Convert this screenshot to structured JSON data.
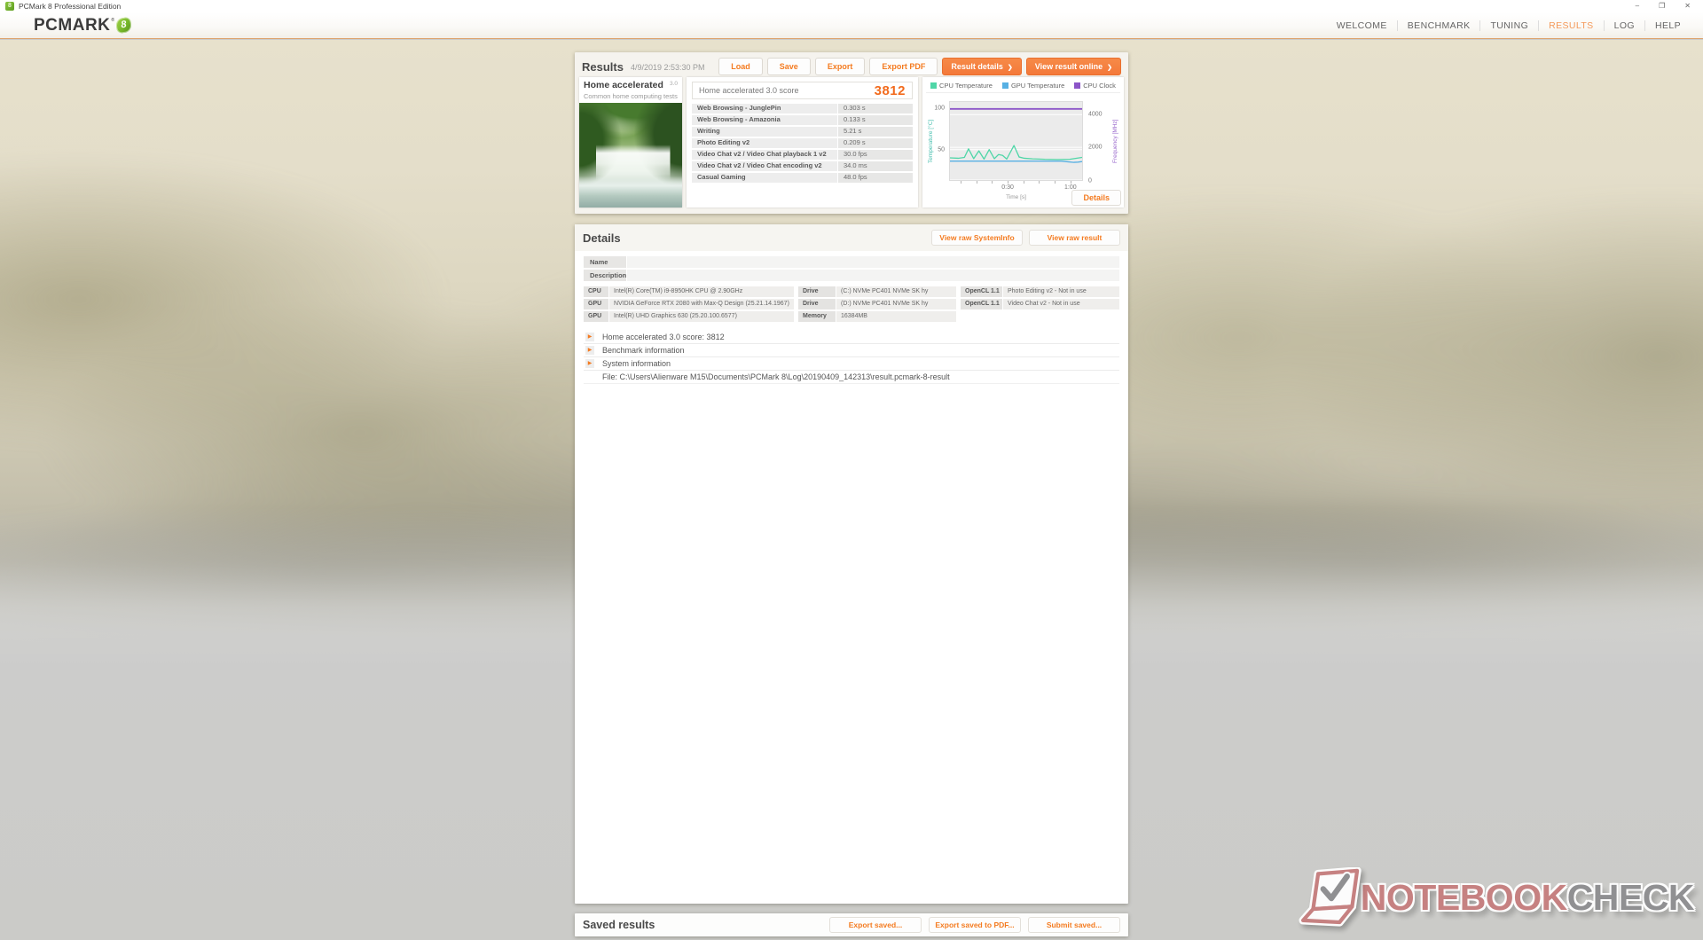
{
  "window": {
    "title": "PCMark 8 Professional Edition",
    "controls": {
      "minimize": "–",
      "maximize": "❐",
      "close": "✕"
    }
  },
  "header": {
    "logo_text": "PCMARK",
    "logo_reg": "®",
    "logo_mark": "8",
    "nav": [
      {
        "label": "WELCOME",
        "active": false
      },
      {
        "label": "BENCHMARK",
        "active": false
      },
      {
        "label": "TUNING",
        "active": false
      },
      {
        "label": "RESULTS",
        "active": true
      },
      {
        "label": "LOG",
        "active": false
      },
      {
        "label": "HELP",
        "active": false
      }
    ]
  },
  "icons": {
    "chevron_right": "❯",
    "expand_arrow": "▶"
  },
  "colors": {
    "accent_orange": "#f47b20",
    "button_orange": "#f4793a",
    "logo_green": "#76b82a"
  },
  "results_panel": {
    "title": "Results",
    "timestamp": "4/9/2019 2:53:30 PM",
    "buttons": {
      "load": "Load",
      "save": "Save",
      "export": "Export",
      "export_pdf": "Export PDF",
      "result_details": "Result details",
      "view_online": "View result online"
    },
    "benchmark": {
      "name": "Home accelerated",
      "version": "3.0",
      "subtitle": "Common home computing tests"
    },
    "score": {
      "label": "Home accelerated 3.0 score",
      "value": "3812"
    },
    "tests": [
      {
        "name": "Web Browsing - JunglePin",
        "value": "0.303 s"
      },
      {
        "name": "Web Browsing - Amazonia",
        "value": "0.133 s"
      },
      {
        "name": "Writing",
        "value": "5.21 s"
      },
      {
        "name": "Photo Editing v2",
        "value": "0.209 s"
      },
      {
        "name": "Video Chat v2 / Video Chat playback 1 v2",
        "value": "30.0 fps"
      },
      {
        "name": "Video Chat v2 / Video Chat encoding v2",
        "value": "34.0 ms"
      },
      {
        "name": "Casual Gaming",
        "value": "48.0 fps"
      }
    ],
    "chart_details_label": "Details"
  },
  "chart_data": {
    "type": "line",
    "title": "",
    "legend_position": "top",
    "grid": true,
    "plot_background": "#ebebeb",
    "x_range": [
      2,
      66
    ],
    "x_axis": {
      "label": "Time [s]",
      "ticks": [
        {
          "label": "0:30",
          "t": 30
        },
        {
          "label": "1:00",
          "t": 60
        }
      ],
      "minor_ticks": [
        7.5,
        15,
        22.5,
        30,
        37.5,
        45,
        52.5,
        60
      ]
    },
    "y_left": {
      "label": "Temperature [°C]",
      "ticks": [
        100,
        50
      ],
      "range": [
        13,
        108
      ],
      "color": "#4bc0b0"
    },
    "y_right": {
      "label": "Frequency [MHz]",
      "ticks": [
        4000,
        2000,
        0
      ],
      "range": [
        0,
        4775
      ],
      "color": "#9a68cc"
    },
    "series": [
      {
        "name": "CPU Temperature",
        "axis": "left",
        "unit": "°C",
        "color": "#4fd6a7",
        "points": [
          [
            2,
            40
          ],
          [
            6,
            39.5
          ],
          [
            9,
            40.5
          ],
          [
            11,
            51
          ],
          [
            13.5,
            39
          ],
          [
            16,
            48.5
          ],
          [
            18.5,
            38.5
          ],
          [
            21,
            50
          ],
          [
            23.5,
            39
          ],
          [
            25.5,
            44
          ],
          [
            27.5,
            43
          ],
          [
            29.5,
            38.5
          ],
          [
            33,
            55
          ],
          [
            35.5,
            41
          ],
          [
            38,
            39.5
          ],
          [
            42,
            38.8
          ],
          [
            48,
            38.2
          ],
          [
            54,
            38
          ],
          [
            60,
            38.2
          ],
          [
            66,
            40.5
          ]
        ]
      },
      {
        "name": "GPU Temperature",
        "axis": "left",
        "unit": "°C",
        "color": "#57b0e3",
        "points": [
          [
            2,
            36
          ],
          [
            20,
            36
          ],
          [
            40,
            36
          ],
          [
            56,
            36
          ],
          [
            59,
            35.2
          ],
          [
            62,
            34.5
          ],
          [
            64,
            34.8
          ],
          [
            66,
            35.5
          ]
        ]
      },
      {
        "name": "CPU Clock",
        "axis": "right",
        "unit": "MHz",
        "color": "#8c55c8",
        "points": [
          [
            2,
            4350
          ],
          [
            66,
            4350
          ]
        ]
      }
    ]
  },
  "details_panel": {
    "title": "Details",
    "raw_buttons": {
      "systeminfo": "View raw SystemInfo",
      "result": "View raw result"
    },
    "fields": [
      {
        "label": "Name",
        "value": ""
      },
      {
        "label": "Description",
        "value": ""
      }
    ],
    "specs": [
      {
        "c1": "CPU",
        "v1": "Intel(R) Core(TM) i9-8950HK CPU @ 2.90GHz",
        "c2": "Drive",
        "v2": "(C:) NVMe PC401 NVMe SK hy",
        "c3": "OpenCL 1.1",
        "v3": "Photo Editing v2 - Not in use"
      },
      {
        "c1": "GPU",
        "v1": "NVIDIA GeForce RTX 2080 with Max-Q Design (25.21.14.1967)",
        "c2": "Drive",
        "v2": "(D:) NVMe PC401 NVMe SK hy",
        "c3": "OpenCL 1.1",
        "v3": "Video Chat v2 - Not in use"
      },
      {
        "c1": "GPU",
        "v1": "Intel(R) UHD Graphics 630 (25.20.100.6577)",
        "c2": "Memory",
        "v2": "16384MB",
        "c3": "",
        "v3": ""
      }
    ],
    "expandables": [
      "Home accelerated 3.0 score: 3812",
      "Benchmark information",
      "System information"
    ],
    "file_line": "File: C:\\Users\\Alienware M15\\Documents\\PCMark 8\\Log\\20190409_142313\\result.pcmark-8-result"
  },
  "saved_results": {
    "title": "Saved results",
    "buttons": {
      "export": "Export saved...",
      "export_pdf": "Export saved to PDF...",
      "submit": "Submit saved..."
    }
  },
  "watermark": {
    "part1": "NOTEBOOK",
    "part2": "CHECK"
  }
}
